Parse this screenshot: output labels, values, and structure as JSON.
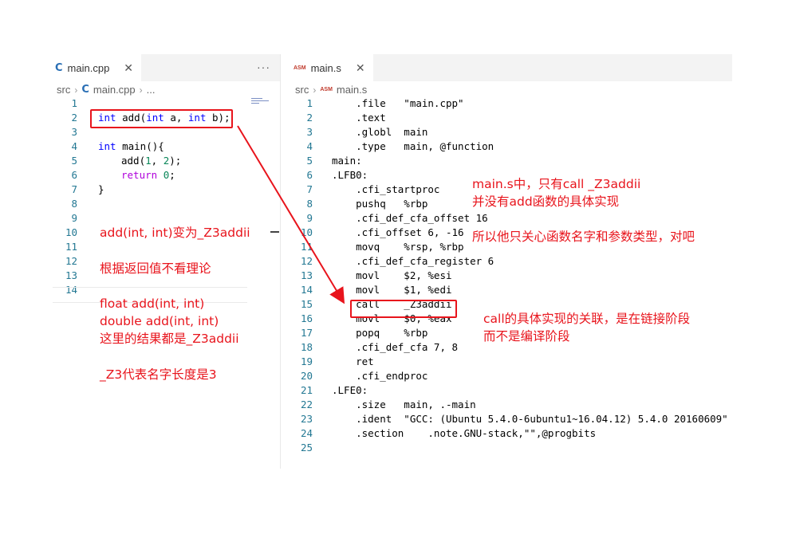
{
  "left": {
    "tab": {
      "icon": "cpp-icon",
      "label": "main.cpp",
      "close": "✕",
      "more": "···"
    },
    "breadcrumb": {
      "folder": "src",
      "file": "main.cpp",
      "tail": "..."
    },
    "line_numbers": [
      "1",
      "2",
      "3",
      "4",
      "5",
      "6",
      "7",
      "8",
      "9",
      "10",
      "11",
      "12",
      "13",
      "14"
    ],
    "code": {
      "l2": {
        "kw1": "int",
        "t1": " add(",
        "kw2": "int",
        "t2": " a, ",
        "kw3": "int",
        "t3": " b);"
      },
      "l4": {
        "kw1": "int",
        "t1": " main(){"
      },
      "l5": {
        "t1": "add(",
        "n1": "1",
        "t2": ", ",
        "n2": "2",
        "t3": ");"
      },
      "l6": {
        "ct": "return",
        "sp": " ",
        "n1": "0",
        "t1": ";"
      },
      "l7": {
        "t1": "}"
      }
    }
  },
  "right": {
    "tab": {
      "icon": "asm-icon",
      "icon_text": "ASM",
      "label": "main.s",
      "close": "✕"
    },
    "breadcrumb": {
      "folder": "src",
      "file": "main.s"
    },
    "lines": [
      {
        "n": "1",
        "text": "    .file   \"main.cpp\""
      },
      {
        "n": "2",
        "text": "    .text"
      },
      {
        "n": "3",
        "text": "    .globl  main"
      },
      {
        "n": "4",
        "text": "    .type   main, @function"
      },
      {
        "n": "5",
        "text": "main:"
      },
      {
        "n": "6",
        "text": ".LFB0:"
      },
      {
        "n": "7",
        "text": "    .cfi_startproc"
      },
      {
        "n": "8",
        "text": "    pushq   %rbp"
      },
      {
        "n": "9",
        "text": "    .cfi_def_cfa_offset 16"
      },
      {
        "n": "10",
        "text": "    .cfi_offset 6, -16"
      },
      {
        "n": "11",
        "text": "    movq    %rsp, %rbp"
      },
      {
        "n": "12",
        "text": "    .cfi_def_cfa_register 6"
      },
      {
        "n": "13",
        "text": "    movl    $2, %esi"
      },
      {
        "n": "14",
        "text": "    movl    $1, %edi"
      },
      {
        "n": "15",
        "text": "    call    _Z3addii"
      },
      {
        "n": "16",
        "text": "    movl    $0, %eax"
      },
      {
        "n": "17",
        "text": "    popq    %rbp"
      },
      {
        "n": "18",
        "text": "    .cfi_def_cfa 7, 8"
      },
      {
        "n": "19",
        "text": "    ret"
      },
      {
        "n": "20",
        "text": "    .cfi_endproc"
      },
      {
        "n": "21",
        "text": ".LFE0:"
      },
      {
        "n": "22",
        "text": "    .size   main, .-main"
      },
      {
        "n": "23",
        "text": "    .ident  \"GCC: (Ubuntu 5.4.0-6ubuntu1~16.04.12) 5.4.0 20160609\""
      },
      {
        "n": "24",
        "text": "    .section    .note.GNU-stack,\"\",@progbits"
      },
      {
        "n": "25",
        "text": ""
      }
    ]
  },
  "annotations": {
    "note1": "add(int, int)变为_Z3addii",
    "note2": "根据返回值不看理论",
    "note3": "float add(int, int)\ndouble add(int, int)\n这里的结果都是_Z3addii",
    "note4": "_Z3代表名字长度是3",
    "note5": "main.s中，只有call _Z3addii\n并没有add函数的具体实现",
    "note6": "所以他只关心函数名字和参数类型，对吧",
    "note7": "call的具体实现的关联，是在链接阶段\n而不是编译阶段",
    "color": "#e8141c"
  }
}
